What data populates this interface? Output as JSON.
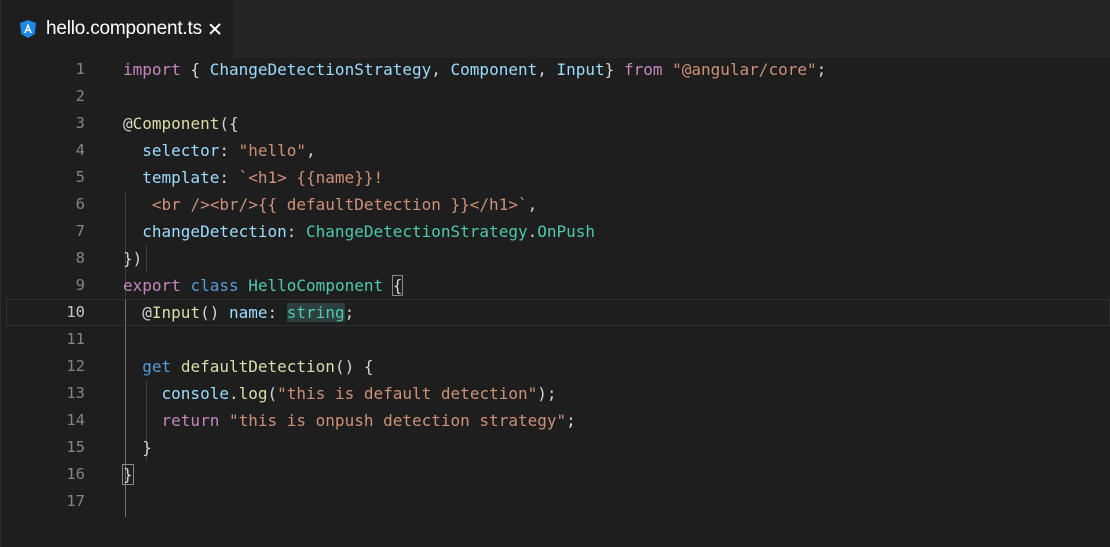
{
  "tab": {
    "title": "hello.component.ts",
    "icon": "angular-icon",
    "close_icon": "close-icon"
  },
  "editor": {
    "current_line": 10,
    "lines": [
      {
        "n": "1",
        "tokens": [
          {
            "t": "import",
            "c": "k-purple"
          },
          {
            "t": " { ",
            "c": "k-punc"
          },
          {
            "t": "ChangeDetectionStrategy",
            "c": "k-var"
          },
          {
            "t": ", ",
            "c": "k-punc"
          },
          {
            "t": "Component",
            "c": "k-var"
          },
          {
            "t": ", ",
            "c": "k-punc"
          },
          {
            "t": "Input",
            "c": "k-var"
          },
          {
            "t": "} ",
            "c": "k-punc"
          },
          {
            "t": "from",
            "c": "k-purple"
          },
          {
            "t": " ",
            "c": "k-punc"
          },
          {
            "t": "\"@angular/core\"",
            "c": "k-str"
          },
          {
            "t": ";",
            "c": "k-punc"
          }
        ]
      },
      {
        "n": "2",
        "tokens": []
      },
      {
        "n": "3",
        "tokens": [
          {
            "t": "@",
            "c": "k-punc"
          },
          {
            "t": "Component",
            "c": "k-fn"
          },
          {
            "t": "({",
            "c": "k-punc"
          }
        ]
      },
      {
        "n": "4",
        "tokens": [
          {
            "t": "  ",
            "c": "k-punc"
          },
          {
            "t": "selector",
            "c": "k-var"
          },
          {
            "t": ": ",
            "c": "k-punc"
          },
          {
            "t": "\"hello\"",
            "c": "k-str"
          },
          {
            "t": ",",
            "c": "k-punc"
          }
        ]
      },
      {
        "n": "5",
        "tokens": [
          {
            "t": "  ",
            "c": "k-punc"
          },
          {
            "t": "template",
            "c": "k-var"
          },
          {
            "t": ": ",
            "c": "k-punc"
          },
          {
            "t": "`<h1> {{name}}!",
            "c": "k-str"
          }
        ]
      },
      {
        "n": "6",
        "tokens": [
          {
            "t": "   ",
            "c": "k-punc"
          },
          {
            "t": "<br /><br/>{{ defaultDetection }}</h1>`",
            "c": "k-str"
          },
          {
            "t": ",",
            "c": "k-punc"
          }
        ]
      },
      {
        "n": "7",
        "tokens": [
          {
            "t": "  ",
            "c": "k-punc"
          },
          {
            "t": "changeDetection",
            "c": "k-var"
          },
          {
            "t": ": ",
            "c": "k-punc"
          },
          {
            "t": "ChangeDetectionStrategy",
            "c": "k-teal"
          },
          {
            "t": ".",
            "c": "k-punc"
          },
          {
            "t": "OnPush",
            "c": "k-teal"
          }
        ]
      },
      {
        "n": "8",
        "tokens": [
          {
            "t": "})",
            "c": "k-punc"
          }
        ]
      },
      {
        "n": "9",
        "tokens": [
          {
            "t": "export",
            "c": "k-purple"
          },
          {
            "t": " ",
            "c": "k-punc"
          },
          {
            "t": "class",
            "c": "k-blue"
          },
          {
            "t": " ",
            "c": "k-punc"
          },
          {
            "t": "HelloComponent",
            "c": "k-teal"
          },
          {
            "t": " ",
            "c": "k-punc"
          },
          {
            "t": "{",
            "c": "k-punc bracket-box"
          }
        ]
      },
      {
        "n": "10",
        "tokens": [
          {
            "t": "  ",
            "c": "k-punc"
          },
          {
            "t": "@",
            "c": "k-punc"
          },
          {
            "t": "Input",
            "c": "k-fn"
          },
          {
            "t": "() ",
            "c": "k-punc"
          },
          {
            "t": "name",
            "c": "k-var"
          },
          {
            "t": ": ",
            "c": "k-punc"
          },
          {
            "t": "string",
            "c": "k-teal sel-word"
          },
          {
            "t": ";",
            "c": "k-punc"
          }
        ]
      },
      {
        "n": "11",
        "tokens": []
      },
      {
        "n": "12",
        "tokens": [
          {
            "t": "  ",
            "c": "k-punc"
          },
          {
            "t": "get",
            "c": "k-blue"
          },
          {
            "t": " ",
            "c": "k-punc"
          },
          {
            "t": "defaultDetection",
            "c": "k-fn"
          },
          {
            "t": "() {",
            "c": "k-punc"
          }
        ]
      },
      {
        "n": "13",
        "tokens": [
          {
            "t": "    ",
            "c": "k-punc"
          },
          {
            "t": "console",
            "c": "k-var"
          },
          {
            "t": ".",
            "c": "k-punc"
          },
          {
            "t": "log",
            "c": "k-fn"
          },
          {
            "t": "(",
            "c": "k-punc"
          },
          {
            "t": "\"this is default detection\"",
            "c": "k-str"
          },
          {
            "t": ");",
            "c": "k-punc"
          }
        ]
      },
      {
        "n": "14",
        "tokens": [
          {
            "t": "    ",
            "c": "k-punc"
          },
          {
            "t": "return",
            "c": "k-purple"
          },
          {
            "t": " ",
            "c": "k-punc"
          },
          {
            "t": "\"this is onpush detection strategy\"",
            "c": "k-str"
          },
          {
            "t": ";",
            "c": "k-punc"
          }
        ]
      },
      {
        "n": "15",
        "tokens": [
          {
            "t": "  }",
            "c": "k-punc"
          }
        ]
      },
      {
        "n": "16",
        "tokens": [
          {
            "t": "}",
            "c": "k-punc bracket-box"
          }
        ]
      },
      {
        "n": "17",
        "tokens": []
      }
    ]
  },
  "colors": {
    "background": "#1e1e1e",
    "tabbar": "#252526",
    "keyword_purple": "#c586c0",
    "keyword_blue": "#569cd6",
    "type_teal": "#4ec9b0",
    "variable": "#9cdcfe",
    "function": "#dcdcaa",
    "string": "#ce9178",
    "angular_icon": "#1e88e5"
  }
}
